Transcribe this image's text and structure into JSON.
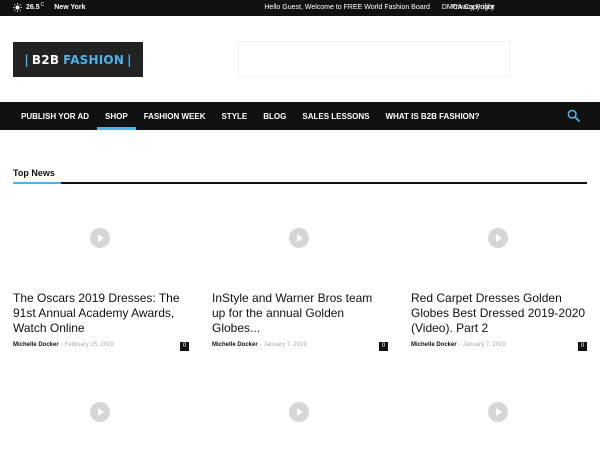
{
  "topbar": {
    "temperature": "26.5",
    "unit": "C",
    "city": "New York",
    "links": [
      "Hello Guest, Welcome to FREE World Fashion Board",
      "DMCA Copyright"
    ],
    "privacy": "Privacy Policy"
  },
  "logo": {
    "b2b": "B2B",
    "fashion": "FASHION",
    "bar": "|"
  },
  "nav": {
    "items": [
      "PUBLISH YOR AD",
      "SHOP",
      "FASHION WEEK",
      "STYLE",
      "BLOG",
      "SALES LESSONS",
      "WHAT IS B2B FASHION?"
    ],
    "active_index": 1
  },
  "section": {
    "title": "Top News"
  },
  "cards": [
    {
      "title": "The Oscars 2019 Dresses: The 91st Annual Academy Awards, Watch Online",
      "author": "Michelle Docker",
      "date": "February 25, 2019",
      "comments": "0"
    },
    {
      "title": "InStyle and Warner Bros team up for the annual Golden Globes...",
      "author": "Michelle Docker",
      "date": "January 7, 2019",
      "comments": "0"
    },
    {
      "title": "Red Carpet Dresses Golden Globes Best Dressed 2019-2020 (Video). Part 2",
      "author": "Michelle Docker",
      "date": "January 7, 2019",
      "comments": "0"
    }
  ],
  "colors": {
    "accent": "#4db2ec",
    "dark": "#111111"
  }
}
